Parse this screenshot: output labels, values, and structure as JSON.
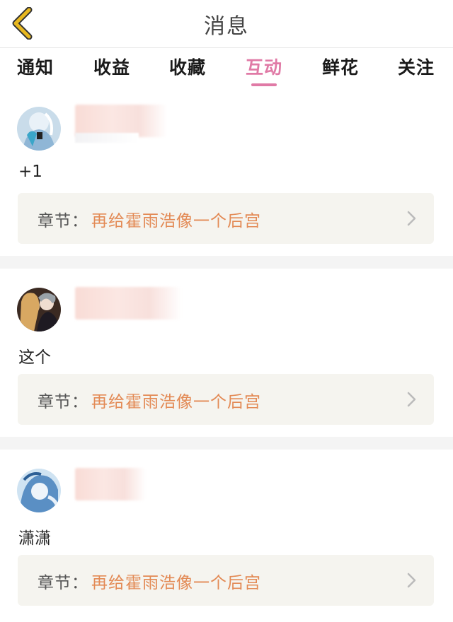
{
  "header": {
    "title": "消息",
    "back_icon": "chevron-left-icon",
    "back_color": "#e8b820"
  },
  "tabs": [
    {
      "label": "通知",
      "active": false
    },
    {
      "label": "收益",
      "active": false
    },
    {
      "label": "收藏",
      "active": false
    },
    {
      "label": "互动",
      "active": true
    },
    {
      "label": "鲜花",
      "active": false
    },
    {
      "label": "关注",
      "active": false
    }
  ],
  "accent_color": "#e07aa6",
  "items": [
    {
      "comment": "+1",
      "chapter_label": "章节：",
      "chapter_title": "再给霍雨浩像一个后宫"
    },
    {
      "comment": "这个",
      "chapter_label": "章节：",
      "chapter_title": "再给霍雨浩像一个后宫"
    },
    {
      "comment": "潇潇",
      "chapter_label": "章节：",
      "chapter_title": "再给霍雨浩像一个后宫"
    }
  ]
}
